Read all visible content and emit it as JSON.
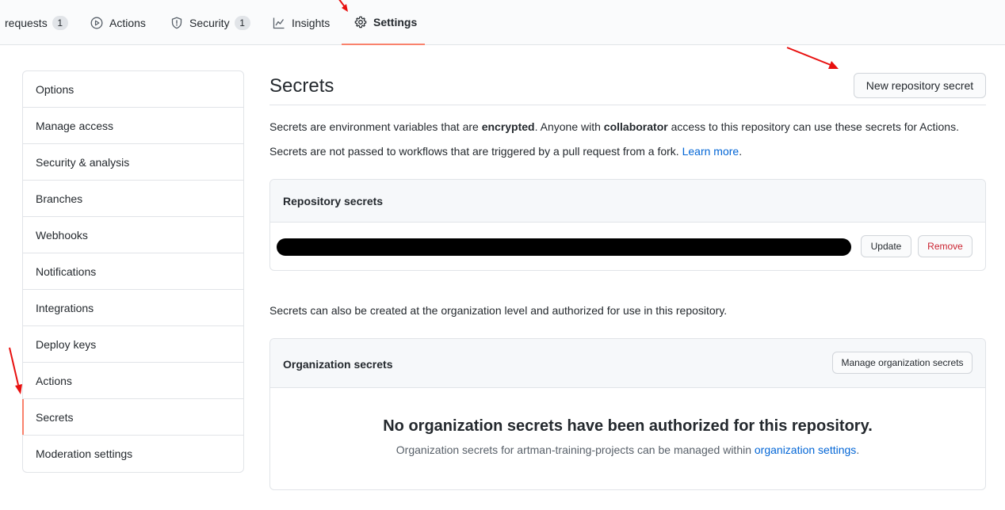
{
  "nav": {
    "tabs": [
      {
        "label": "requests",
        "counter": "1"
      },
      {
        "label": "Actions"
      },
      {
        "label": "Security",
        "counter": "1"
      },
      {
        "label": "Insights"
      },
      {
        "label": "Settings"
      }
    ]
  },
  "sidebar": {
    "items": [
      {
        "label": "Options"
      },
      {
        "label": "Manage access"
      },
      {
        "label": "Security & analysis"
      },
      {
        "label": "Branches"
      },
      {
        "label": "Webhooks"
      },
      {
        "label": "Notifications"
      },
      {
        "label": "Integrations"
      },
      {
        "label": "Deploy keys"
      },
      {
        "label": "Actions"
      },
      {
        "label": "Secrets"
      },
      {
        "label": "Moderation settings"
      }
    ]
  },
  "main": {
    "title": "Secrets",
    "new_secret_label": "New repository secret",
    "intro": {
      "part1": "Secrets are environment variables that are ",
      "encrypted": "encrypted",
      "part2": ". Anyone with ",
      "collaborator": "collaborator",
      "part3": " access to this repository can use these secrets for Actions."
    },
    "fork_note": {
      "text": "Secrets are not passed to workflows that are triggered by a pull request from a fork. ",
      "link": "Learn more",
      "end": "."
    },
    "repo_secrets": {
      "title": "Repository secrets",
      "update_label": "Update",
      "remove_label": "Remove"
    },
    "org_note": "Secrets can also be created at the organization level and authorized for use in this repository.",
    "org_secrets": {
      "title": "Organization secrets",
      "manage_label": "Manage organization secrets",
      "empty_title": "No organization secrets have been authorized for this repository.",
      "empty_text": "Organization secrets for artman-training-projects can be managed within ",
      "empty_link": "organization settings",
      "empty_end": "."
    }
  },
  "colors": {
    "accent": "#f9826c",
    "link": "#0366d6",
    "danger": "#cb2431",
    "annotation_arrow": "#e8100f"
  }
}
